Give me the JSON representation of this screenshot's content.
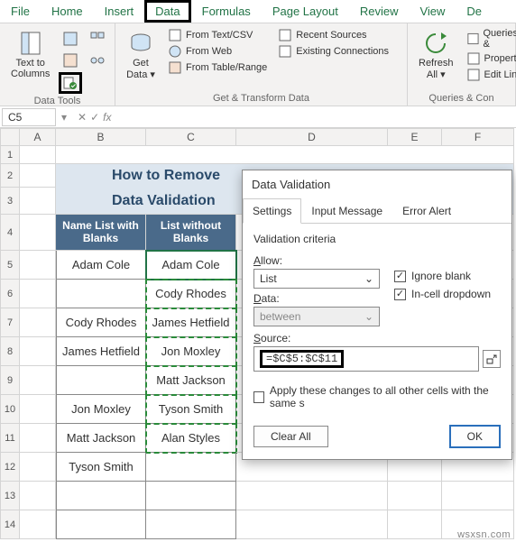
{
  "ribbon": {
    "tabs": [
      "File",
      "Home",
      "Insert",
      "Data",
      "Formulas",
      "Page Layout",
      "Review",
      "View",
      "De"
    ],
    "active": "Data",
    "groups": {
      "dataTools": "Data Tools",
      "getTransform": "Get & Transform Data",
      "queries": "Queries & Con"
    },
    "items": {
      "textToColumns": "Text to Columns",
      "getData": "Get Data",
      "fromTextCsv": "From Text/CSV",
      "fromWeb": "From Web",
      "fromTableRange": "From Table/Range",
      "recentSources": "Recent Sources",
      "existingConnections": "Existing Connections",
      "refreshAll": "Refresh All",
      "queriesAnd": "Queries &",
      "properties": "Propertie",
      "editLinks": "Edit Link"
    }
  },
  "nameBox": "C5",
  "cols": [
    {
      "l": "A",
      "w": 40
    },
    {
      "l": "B",
      "w": 100
    },
    {
      "l": "C",
      "w": 100
    },
    {
      "l": "D",
      "w": 168
    },
    {
      "l": "E",
      "w": 60
    },
    {
      "l": "F",
      "w": 80
    }
  ],
  "titleLines": [
    "How to Remove",
    "Data Validation"
  ],
  "headers": {
    "b": "Name List with Blanks",
    "c": "List without Blanks"
  },
  "rows": [
    {
      "n": 5,
      "b": "Adam Cole",
      "c": "Adam Cole"
    },
    {
      "n": 6,
      "b": "",
      "c": "Cody Rhodes"
    },
    {
      "n": 7,
      "b": "Cody Rhodes",
      "c": "James Hetfield"
    },
    {
      "n": 8,
      "b": "James Hetfield",
      "c": "Jon Moxley"
    },
    {
      "n": 9,
      "b": "",
      "c": "Matt Jackson"
    },
    {
      "n": 10,
      "b": "Jon Moxley",
      "c": "Tyson Smith"
    },
    {
      "n": 11,
      "b": "Matt Jackson",
      "c": "Alan Styles"
    },
    {
      "n": 12,
      "b": "Tyson Smith",
      "c": ""
    },
    {
      "n": 13,
      "b": "",
      "c": ""
    },
    {
      "n": 14,
      "b": "",
      "c": ""
    }
  ],
  "dialog": {
    "title": "Data Validation",
    "tabs": [
      "Settings",
      "Input Message",
      "Error Alert"
    ],
    "activeTab": "Settings",
    "criteriaLabel": "Validation criteria",
    "allowLabel": "Allow:",
    "allowValue": "List",
    "dataLabel": "Data:",
    "dataValue": "between",
    "ignoreBlank": "Ignore blank",
    "inCellDropdown": "In-cell dropdown",
    "sourceLabel": "Source:",
    "sourceValue": "=$C$5:$C$11",
    "applyLabel": "Apply these changes to all other cells with the same s",
    "clearAll": "Clear All",
    "ok": "OK"
  },
  "watermark": "wsxsn.com"
}
